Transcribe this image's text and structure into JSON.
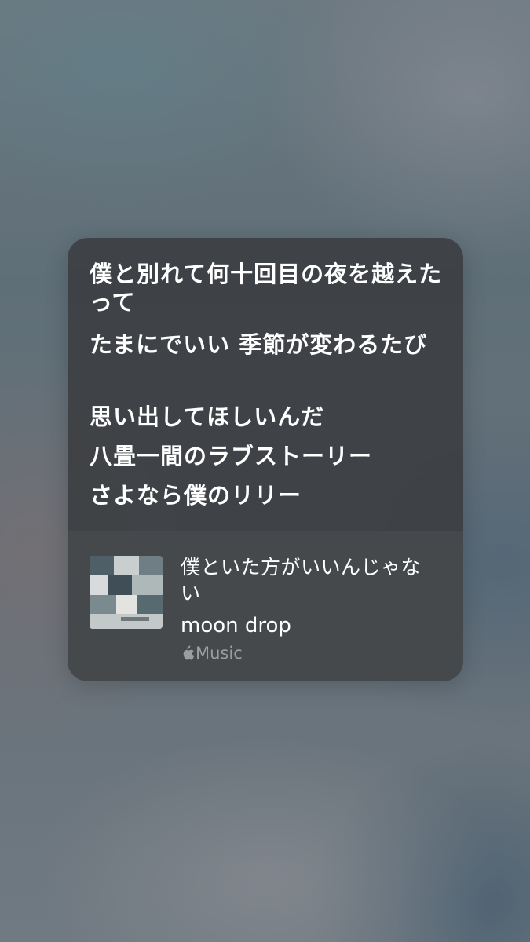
{
  "lyrics": {
    "lines": [
      "僕と別れて何十回目の夜を越えたって",
      "たまにでいい 季節が変わるたび",
      "思い出してほしいんだ",
      "八畳一間のラブストーリー",
      "さよなら僕のリリー"
    ]
  },
  "track": {
    "title": "僕といた方がいいんじゃない",
    "artist": "moon drop",
    "source_label": "Music",
    "source_icon": "apple-logo-icon"
  },
  "colors": {
    "card_background": "#3a3c40",
    "footer_background": "#484a4e",
    "primary_text": "#ffffff",
    "secondary_text": "#9b9da1"
  }
}
